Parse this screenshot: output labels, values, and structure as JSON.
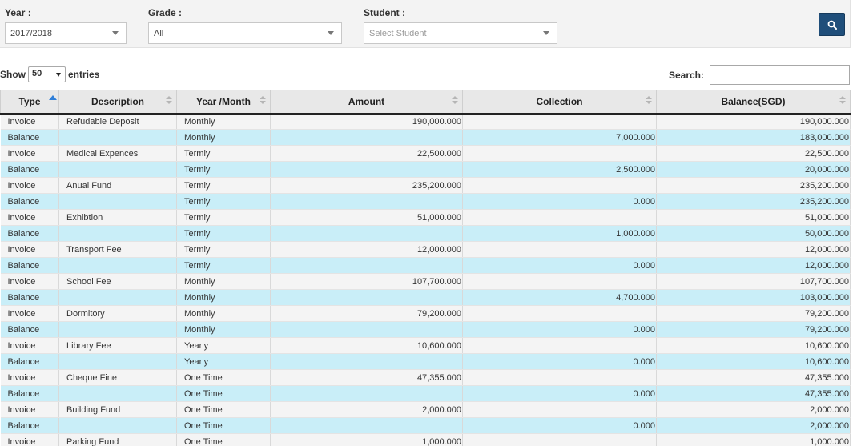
{
  "filters": {
    "year": {
      "label": "Year :",
      "value": "2017/2018"
    },
    "grade": {
      "label": "Grade :",
      "value": "All"
    },
    "student": {
      "label": "Student :",
      "placeholder": "Select Student"
    }
  },
  "search_button": {
    "icon": "search-icon"
  },
  "table_controls": {
    "show_label": "Show",
    "entries_value": "50",
    "entries_label": "entries",
    "search_label": "Search:"
  },
  "table": {
    "columns": [
      "Type",
      "Description",
      "Year /Month",
      "Amount",
      "Collection",
      "Balance(SGD)"
    ],
    "rows": [
      [
        "Invoice",
        "Refudable Deposit",
        "Monthly",
        "190,000.000",
        "",
        "190,000.000"
      ],
      [
        "Balance",
        "",
        "Monthly",
        "",
        "7,000.000",
        "183,000.000"
      ],
      [
        "Invoice",
        "Medical Expences",
        "Termly",
        "22,500.000",
        "",
        "22,500.000"
      ],
      [
        "Balance",
        "",
        "Termly",
        "",
        "2,500.000",
        "20,000.000"
      ],
      [
        "Invoice",
        "Anual Fund",
        "Termly",
        "235,200.000",
        "",
        "235,200.000"
      ],
      [
        "Balance",
        "",
        "Termly",
        "",
        "0.000",
        "235,200.000"
      ],
      [
        "Invoice",
        "Exhibtion",
        "Termly",
        "51,000.000",
        "",
        "51,000.000"
      ],
      [
        "Balance",
        "",
        "Termly",
        "",
        "1,000.000",
        "50,000.000"
      ],
      [
        "Invoice",
        "Transport Fee",
        "Termly",
        "12,000.000",
        "",
        "12,000.000"
      ],
      [
        "Balance",
        "",
        "Termly",
        "",
        "0.000",
        "12,000.000"
      ],
      [
        "Invoice",
        "School Fee",
        "Monthly",
        "107,700.000",
        "",
        "107,700.000"
      ],
      [
        "Balance",
        "",
        "Monthly",
        "",
        "4,700.000",
        "103,000.000"
      ],
      [
        "Invoice",
        "Dormitory",
        "Monthly",
        "79,200.000",
        "",
        "79,200.000"
      ],
      [
        "Balance",
        "",
        "Monthly",
        "",
        "0.000",
        "79,200.000"
      ],
      [
        "Invoice",
        "Library Fee",
        "Yearly",
        "10,600.000",
        "",
        "10,600.000"
      ],
      [
        "Balance",
        "",
        "Yearly",
        "",
        "0.000",
        "10,600.000"
      ],
      [
        "Invoice",
        "Cheque Fine",
        "One Time",
        "47,355.000",
        "",
        "47,355.000"
      ],
      [
        "Balance",
        "",
        "One Time",
        "",
        "0.000",
        "47,355.000"
      ],
      [
        "Invoice",
        "Building Fund",
        "One Time",
        "2,000.000",
        "",
        "2,000.000"
      ],
      [
        "Balance",
        "",
        "One Time",
        "",
        "0.000",
        "2,000.000"
      ],
      [
        "Invoice",
        "Parking Fund",
        "One Time",
        "1,000.000",
        "",
        "1,000.000"
      ]
    ]
  },
  "colors": {
    "accent": "#1f4e7a",
    "invoice_row": "#f4f4f4",
    "balance_row": "#c9eef8",
    "sort_active": "#2f7ed8"
  }
}
